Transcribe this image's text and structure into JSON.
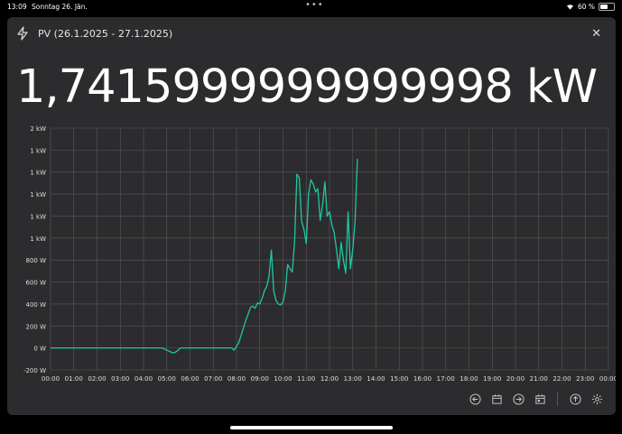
{
  "status_bar": {
    "time": "13:09",
    "date": "Sonntag 26. Jän.",
    "battery": "60 %",
    "battery_level": 0.6
  },
  "dialog": {
    "title": "PV (26.1.2025 - 27.1.2025)",
    "value": "1,7415999999999998 kW",
    "close_icon": "close-icon",
    "title_icon": "lightning-bolt-icon"
  },
  "colors": {
    "line": "#1fc7a4",
    "dialog_bg": "#2c2c2e",
    "grid": "#5a5a5e"
  },
  "chart_data": {
    "type": "line",
    "title": "",
    "xlabel": "",
    "ylabel": "",
    "x_tick_labels": [
      "00:00",
      "01:00",
      "02:00",
      "03:00",
      "04:00",
      "05:00",
      "06:00",
      "07:00",
      "08:00",
      "09:00",
      "10:00",
      "11:00",
      "12:00",
      "13:00",
      "14:00",
      "15:00",
      "16:00",
      "17:00",
      "18:00",
      "19:00",
      "20:00",
      "21:00",
      "22:00",
      "23:00",
      "00:00"
    ],
    "y_tick_labels": [
      "2 kW",
      "1 kW",
      "1 kW",
      "1 kW",
      "1 kW",
      "1 kW",
      "800 W",
      "600 W",
      "400 W",
      "200 W",
      "0 W",
      "-200 W"
    ],
    "ylim": [
      -200,
      2000
    ],
    "xlim": [
      0,
      24
    ],
    "grid": true,
    "series": [
      {
        "x": [
          0,
          4.8,
          5.0,
          5.2,
          5.3,
          5.4,
          5.6,
          7.8,
          7.9,
          8.1,
          8.25,
          8.4,
          8.5,
          8.6,
          8.7,
          8.8,
          8.9,
          9.0,
          9.1,
          9.2,
          9.3,
          9.4,
          9.5,
          9.6,
          9.7,
          9.8,
          9.9,
          10.0,
          10.1,
          10.2,
          10.3,
          10.4,
          10.5,
          10.6,
          10.7,
          10.8,
          10.9,
          11.0,
          11.1,
          11.2,
          11.3,
          11.4,
          11.5,
          11.6,
          11.7,
          11.8,
          11.9,
          12.0,
          12.1,
          12.2,
          12.3,
          12.4,
          12.5,
          12.6,
          12.7,
          12.8,
          12.9,
          13.0,
          13.1,
          13.2
        ],
        "y": [
          0,
          0,
          -20,
          -40,
          -45,
          -35,
          0,
          0,
          -20,
          50,
          150,
          250,
          310,
          370,
          380,
          360,
          410,
          400,
          450,
          520,
          560,
          650,
          890,
          520,
          430,
          400,
          390,
          420,
          520,
          760,
          720,
          690,
          980,
          1580,
          1550,
          1150,
          1080,
          950,
          1400,
          1530,
          1490,
          1420,
          1450,
          1160,
          1300,
          1510,
          1200,
          1240,
          1120,
          1050,
          900,
          720,
          960,
          800,
          680,
          1240,
          720,
          900,
          1150,
          1720
        ]
      }
    ]
  },
  "toolbar": {
    "buttons": [
      "previous-icon",
      "calendar-icon",
      "next-icon",
      "calendar-today-icon",
      "export-icon",
      "settings-icon"
    ]
  }
}
